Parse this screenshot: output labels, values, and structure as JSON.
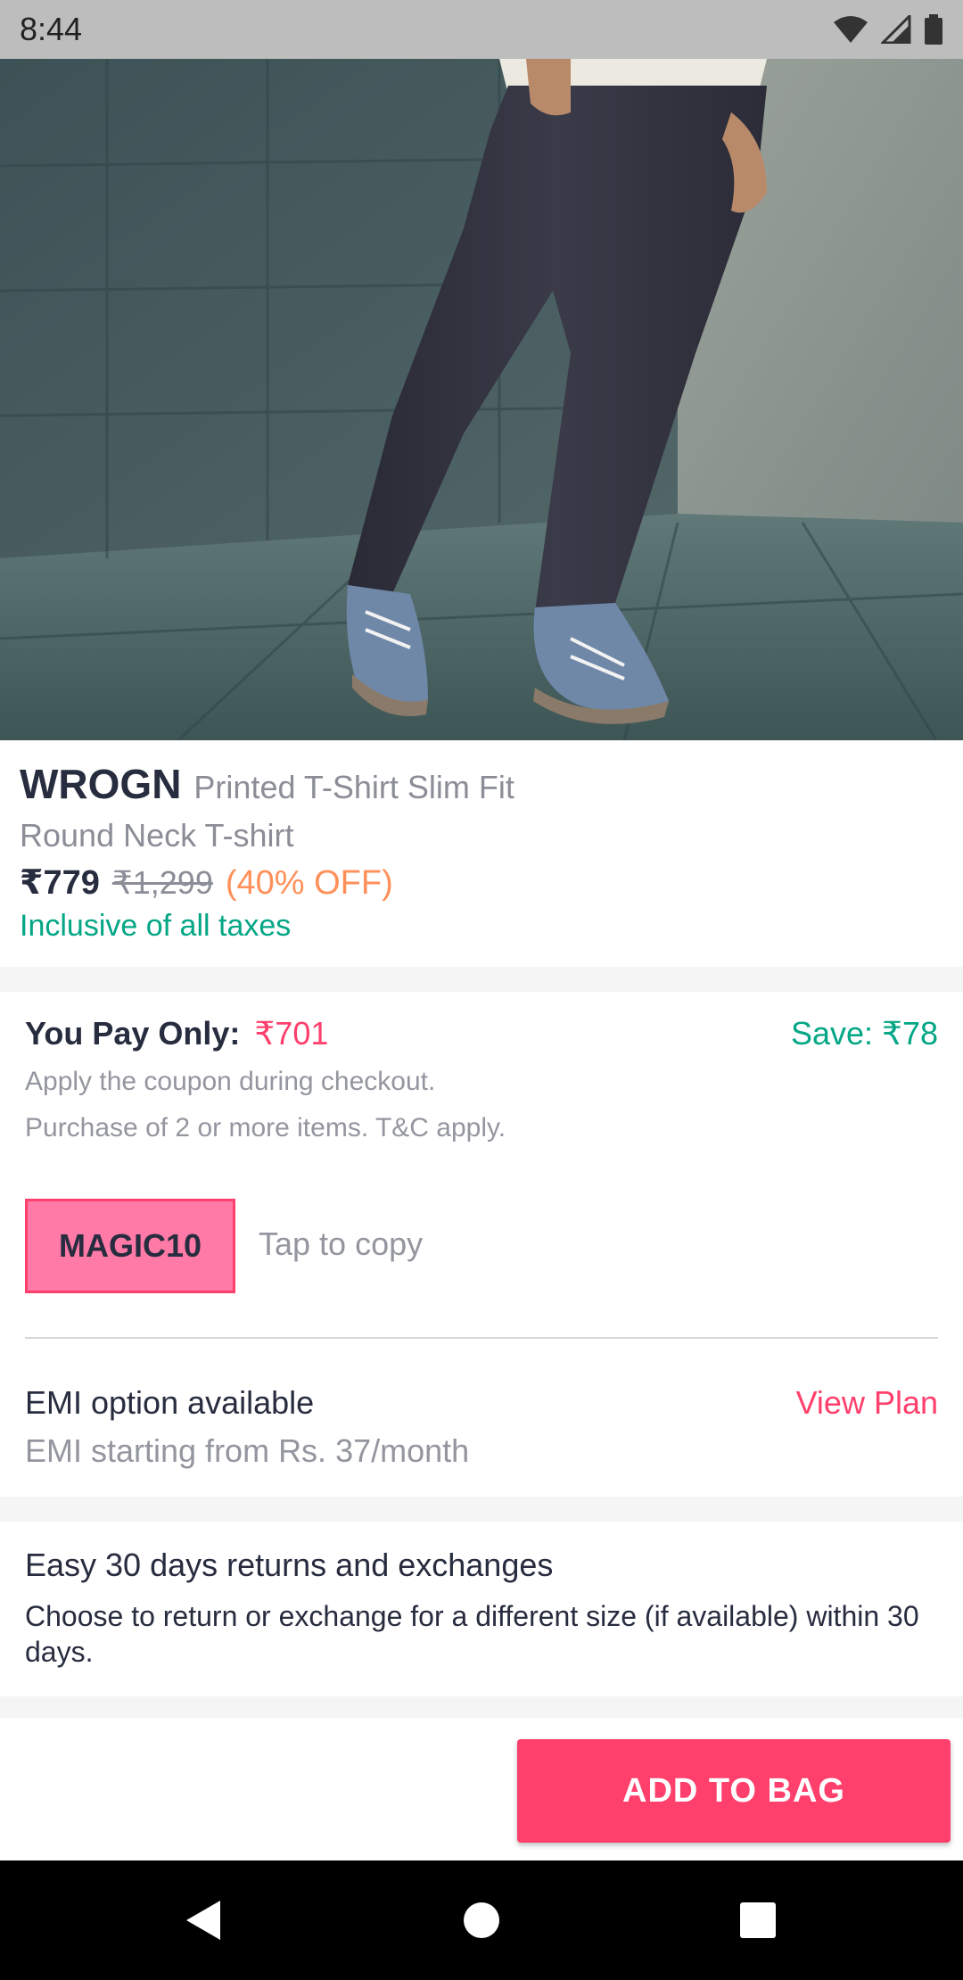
{
  "status_bar": {
    "time": "8:44",
    "icons": [
      "wifi-icon",
      "signal-icon",
      "battery-icon"
    ]
  },
  "hero_image": {
    "description_icon": "product-photo"
  },
  "product": {
    "brand": "WROGN",
    "name_line1": "Printed T-Shirt Slim Fit",
    "name_line2": "Round Neck T-shirt",
    "price": "₹779",
    "mrp": "₹1,299",
    "discount": "(40% OFF)",
    "tax_note": "Inclusive of all taxes"
  },
  "coupon": {
    "pay_label": "You Pay Only:",
    "pay_amount": "₹701",
    "save": "Save: ₹78",
    "desc1": "Apply the coupon during checkout.",
    "desc2": "Purchase of 2 or more items. T&C apply.",
    "code": "MAGIC10",
    "tap_to_copy": "Tap to copy"
  },
  "emi": {
    "title": "EMI option available",
    "subtitle": "EMI starting from Rs. 37/month",
    "view_plan": "View Plan"
  },
  "returns": {
    "title": "Easy 30 days returns and exchanges",
    "description": "Choose to return or exchange for a different size (if available) within 30 days."
  },
  "actions": {
    "add_to_bag": "ADD TO BAG"
  },
  "colors": {
    "accent": "#ff3f6c",
    "success": "#03a685",
    "discount": "#ff905a",
    "coupon_bg": "#ff7aa7"
  },
  "nav_bar": {
    "icons": [
      "back-icon",
      "home-icon",
      "recents-icon"
    ]
  }
}
